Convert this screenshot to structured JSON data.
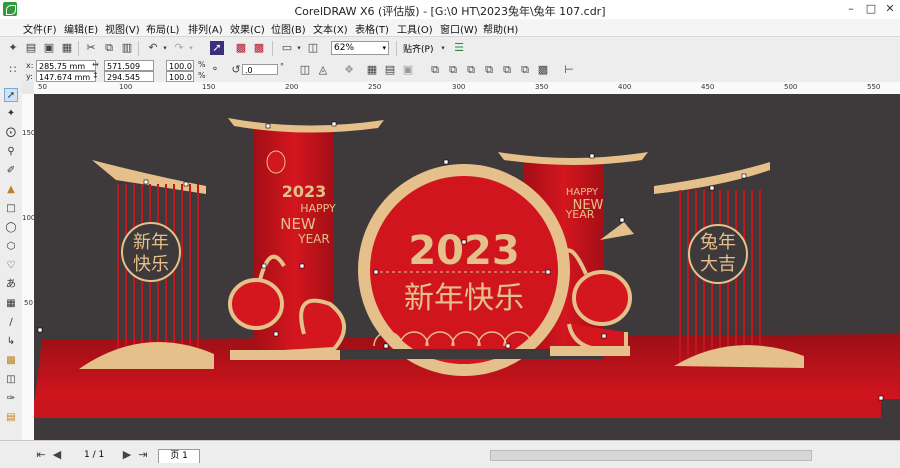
{
  "window": {
    "title": "CorelDRAW X6 (评估版) - [G:\\0 HT\\2023兔年\\兔年 107.cdr]"
  },
  "menu": [
    "文件(F)",
    "编辑(E)",
    "视图(V)",
    "布局(L)",
    "排列(A)",
    "效果(C)",
    "位图(B)",
    "文本(X)",
    "表格(T)",
    "工具(O)",
    "窗口(W)",
    "帮助(H)"
  ],
  "toolbar": {
    "zoom": "62%",
    "snap": "贴齐(P)"
  },
  "props": {
    "x": "285.75 mm",
    "y": "147.674 mm",
    "w": "571.509 mm",
    "h": "294.545 mm",
    "sx": "100.0",
    "sy": "100.0",
    "pct": "%",
    "angle": ".0",
    "deg": "°"
  },
  "ruler": {
    "h_ticks": [
      "50",
      "100",
      "150",
      "200",
      "250",
      "300",
      "350",
      "400",
      "450",
      "500",
      "550"
    ],
    "v_ticks": [
      "150",
      "100",
      "50"
    ]
  },
  "artwork": {
    "big_year": "2023",
    "greeting": "新年快乐",
    "happy": "HAPPY",
    "new": "NEW",
    "year": "YEAR",
    "left_medallion": [
      "新年",
      "快乐"
    ],
    "right_medallion": [
      "兔年",
      "大吉"
    ],
    "colors": {
      "red": "#c4141c",
      "gold": "#e6c08a",
      "bg": "#3e3a3b"
    }
  },
  "status": {
    "page_counter": "1 / 1",
    "page_tab": "页 1"
  }
}
